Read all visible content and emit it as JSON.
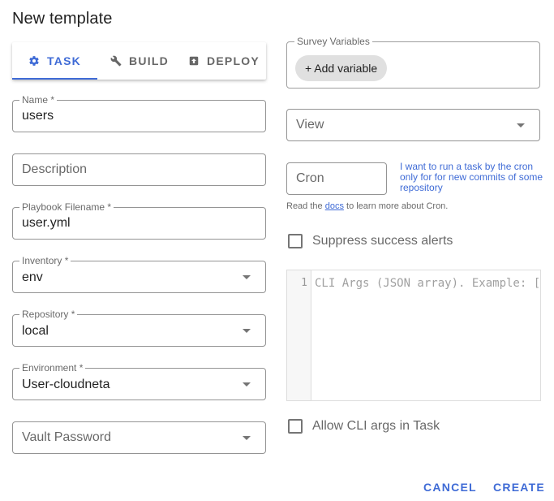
{
  "dialog": {
    "title": "New template"
  },
  "tabs": [
    {
      "label": "TASK",
      "icon": "gear-icon",
      "active": true
    },
    {
      "label": "BUILD",
      "icon": "wrench-icon",
      "active": false
    },
    {
      "label": "DEPLOY",
      "icon": "upload-box-icon",
      "active": false
    }
  ],
  "form": {
    "name": {
      "label": "Name *",
      "value": "users"
    },
    "description": {
      "placeholder": "Description",
      "value": ""
    },
    "playbook": {
      "label": "Playbook Filename *",
      "value": "user.yml"
    },
    "inventory": {
      "label": "Inventory *",
      "value": "env"
    },
    "repository": {
      "label": "Repository *",
      "value": "local"
    },
    "environment": {
      "label": "Environment *",
      "value": "User-cloudneta"
    },
    "vault": {
      "placeholder": "Vault Password",
      "value": ""
    }
  },
  "survey": {
    "label": "Survey Variables",
    "add_button": "+ Add variable"
  },
  "view": {
    "placeholder": "View"
  },
  "cron": {
    "placeholder": "Cron",
    "help": "I want to run a task by the cron only for for new commits of some repository",
    "docs_prefix": "Read the ",
    "docs_link": "docs",
    "docs_suffix": " to learn more about Cron."
  },
  "suppress": {
    "label": "Suppress success alerts",
    "checked": false
  },
  "cli_args": {
    "line_number": "1",
    "placeholder": "CLI Args (JSON array). Example: ["
  },
  "allow_cli": {
    "label": "Allow CLI args in Task",
    "checked": false
  },
  "actions": {
    "cancel": "CANCEL",
    "create": "CREATE"
  },
  "colors": {
    "primary": "#3f6bd6",
    "chip": "#e0e0e0"
  }
}
